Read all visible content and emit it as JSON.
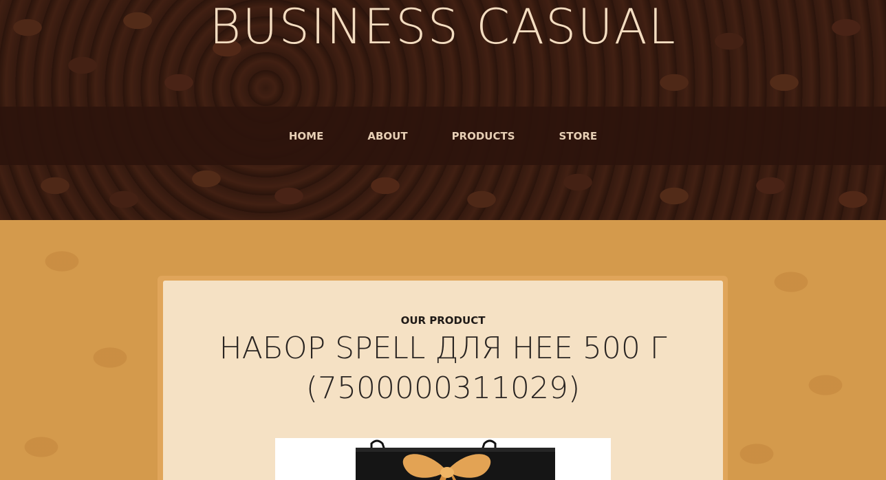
{
  "header": {
    "brand_title": "BUSINESS CASUAL"
  },
  "nav": {
    "items": [
      {
        "label": "HOME"
      },
      {
        "label": "ABOUT"
      },
      {
        "label": "PRODUCTS"
      },
      {
        "label": "STORE"
      }
    ]
  },
  "product": {
    "section_label": "OUR PRODUCT",
    "name": "НАБОР SPELL ДЛЯ НЕЕ 500 Г (7500000311029)",
    "image_alt": "black gift bag with orange ribbon bow"
  },
  "colors": {
    "nav_bg": "#2d140c",
    "page_bg": "#d49a4c",
    "card_bg": "#f5e1c4",
    "accent_ribbon": "#e3a354"
  }
}
